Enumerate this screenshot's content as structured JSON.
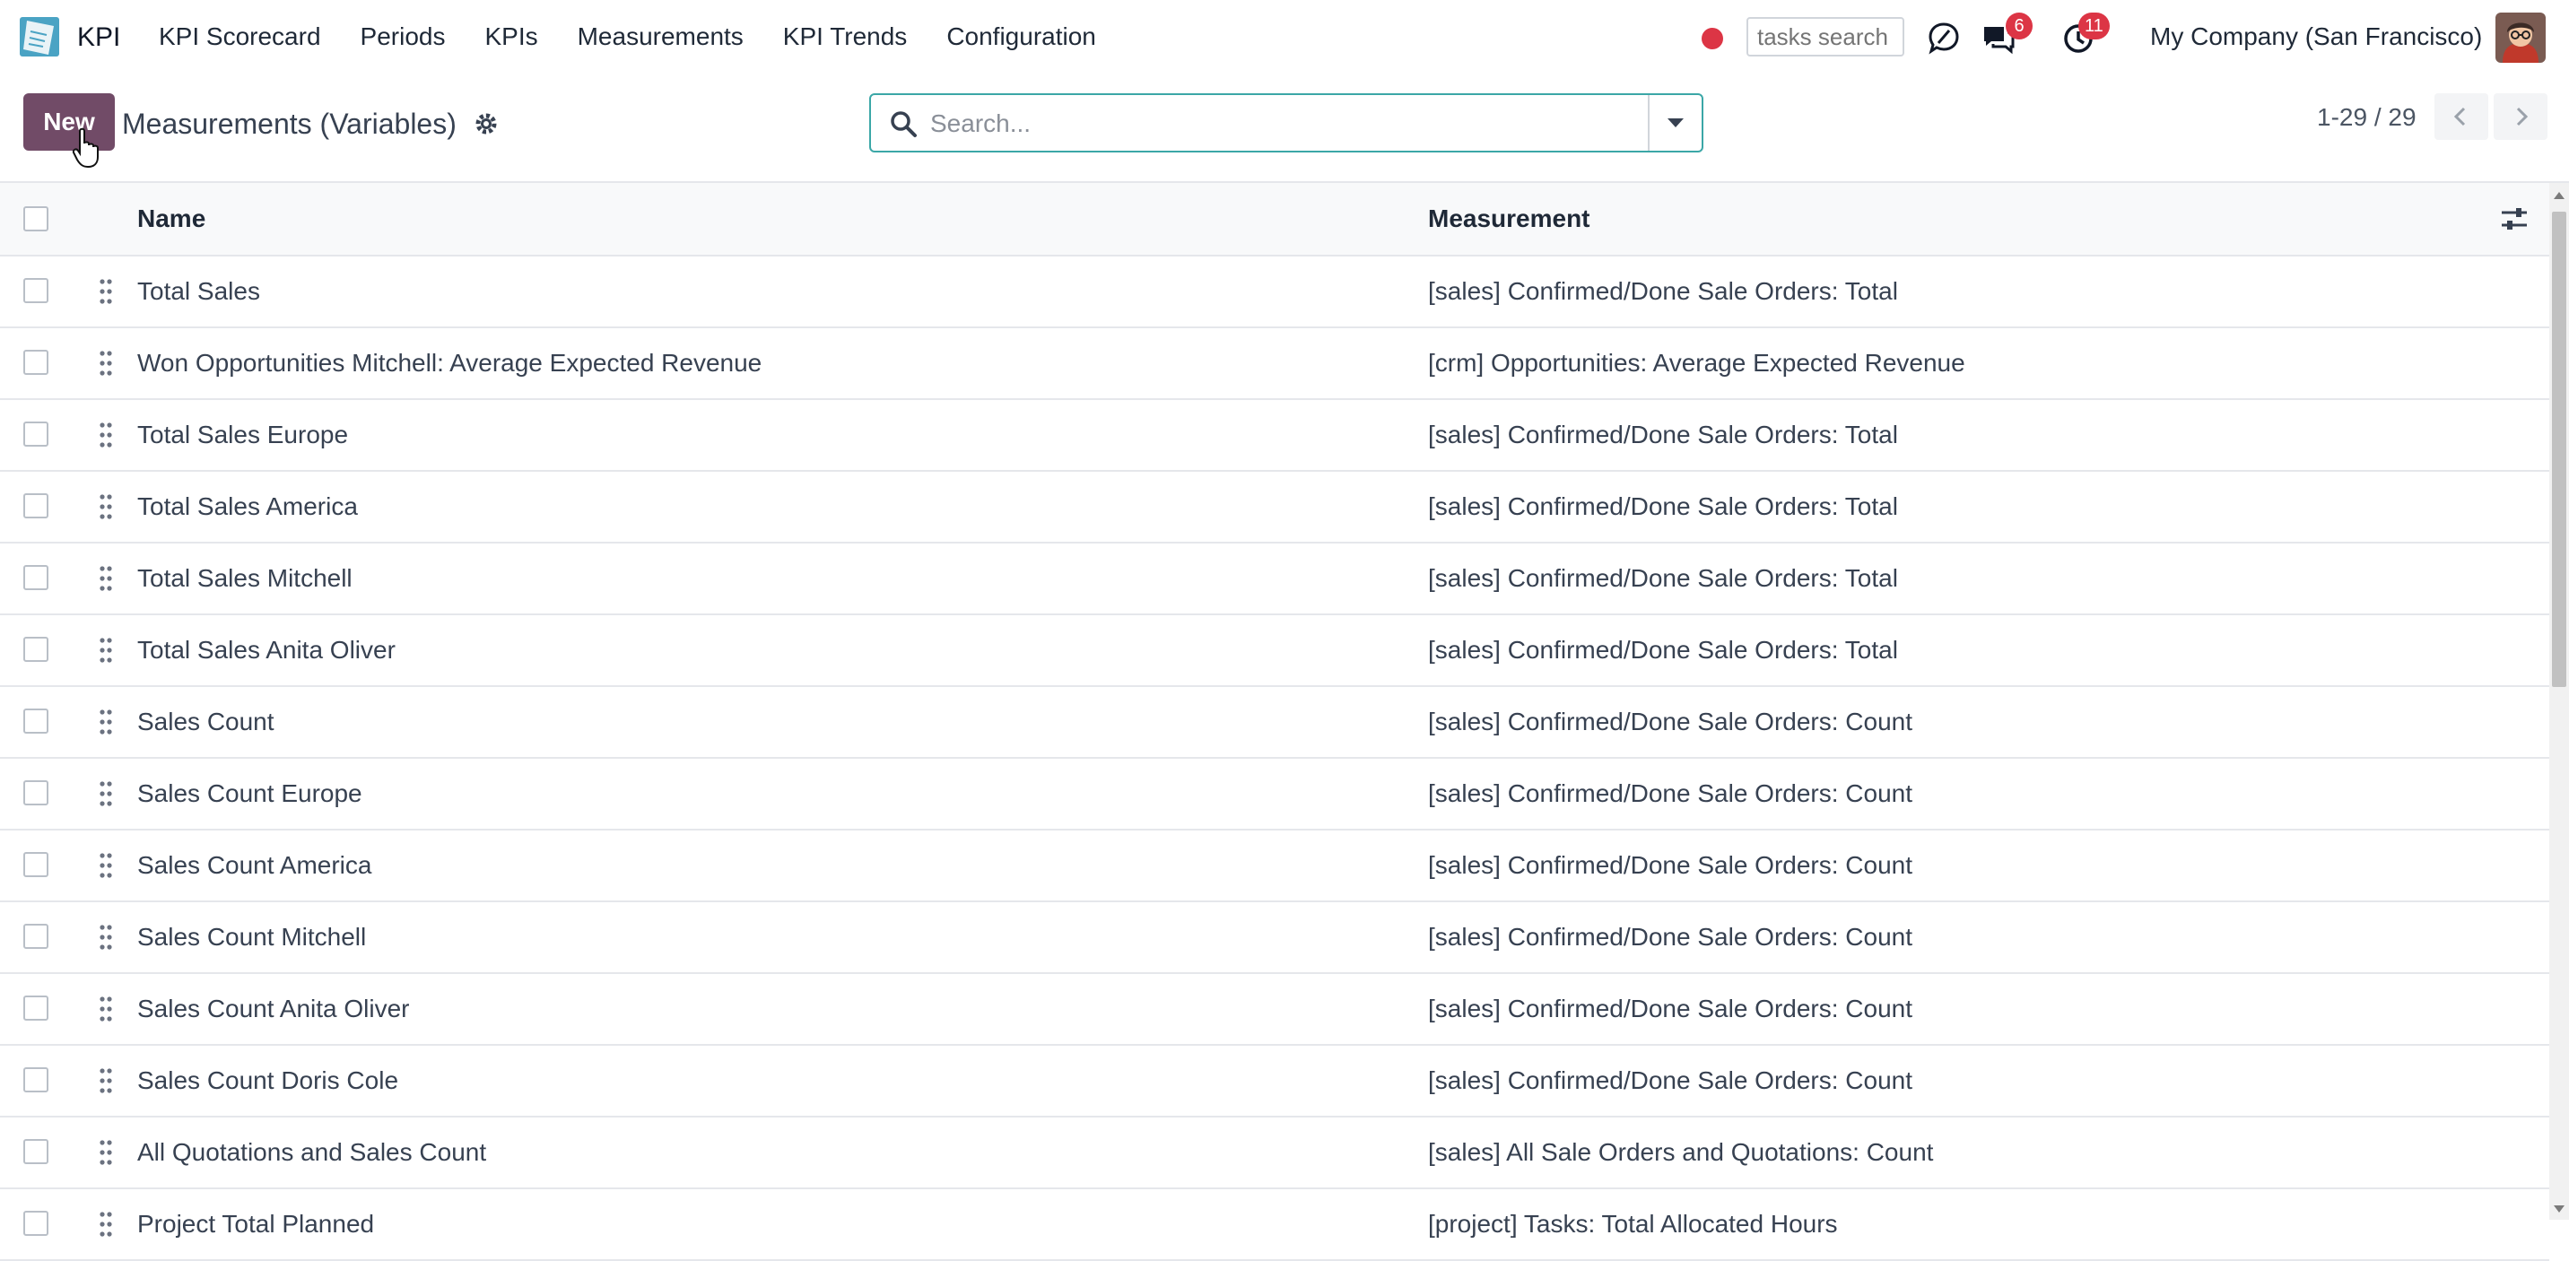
{
  "navbar": {
    "app_name": "KPI",
    "menu": [
      "KPI Scorecard",
      "Periods",
      "KPIs",
      "Measurements",
      "KPI Trends",
      "Configuration"
    ],
    "tasks_search_placeholder": "tasks search",
    "messages_badge": "6",
    "activities_badge": "11",
    "company": "My Company (San Francisco)"
  },
  "control": {
    "new_label": "New",
    "title": "Measurements (Variables)",
    "search_placeholder": "Search...",
    "pager": "1-29 / 29"
  },
  "table": {
    "columns": {
      "name": "Name",
      "measurement": "Measurement"
    },
    "rows": [
      {
        "name": "Total Sales",
        "measurement": "[sales] Confirmed/Done Sale Orders: Total"
      },
      {
        "name": "Won Opportunities Mitchell: Average Expected Revenue",
        "measurement": "[crm] Opportunities: Average Expected Revenue"
      },
      {
        "name": "Total Sales Europe",
        "measurement": "[sales] Confirmed/Done Sale Orders: Total"
      },
      {
        "name": "Total Sales America",
        "measurement": "[sales] Confirmed/Done Sale Orders: Total"
      },
      {
        "name": "Total Sales Mitchell",
        "measurement": "[sales] Confirmed/Done Sale Orders: Total"
      },
      {
        "name": "Total Sales Anita Oliver",
        "measurement": "[sales] Confirmed/Done Sale Orders: Total"
      },
      {
        "name": "Sales Count",
        "measurement": "[sales] Confirmed/Done Sale Orders: Count"
      },
      {
        "name": "Sales Count Europe",
        "measurement": "[sales] Confirmed/Done Sale Orders: Count"
      },
      {
        "name": "Sales Count America",
        "measurement": "[sales] Confirmed/Done Sale Orders: Count"
      },
      {
        "name": "Sales Count Mitchell",
        "measurement": "[sales] Confirmed/Done Sale Orders: Count"
      },
      {
        "name": "Sales Count Anita Oliver",
        "measurement": "[sales] Confirmed/Done Sale Orders: Count"
      },
      {
        "name": "Sales Count Doris Cole",
        "measurement": "[sales] Confirmed/Done Sale Orders: Count"
      },
      {
        "name": "All Quotations and Sales Count",
        "measurement": "[sales] All Sale Orders and Quotations: Count"
      },
      {
        "name": "Project Total Planned",
        "measurement": "[project] Tasks: Total Allocated Hours"
      }
    ]
  },
  "colors": {
    "brand": "#714b67",
    "badge": "#dc3545",
    "search_border": "#3ba7a7"
  }
}
